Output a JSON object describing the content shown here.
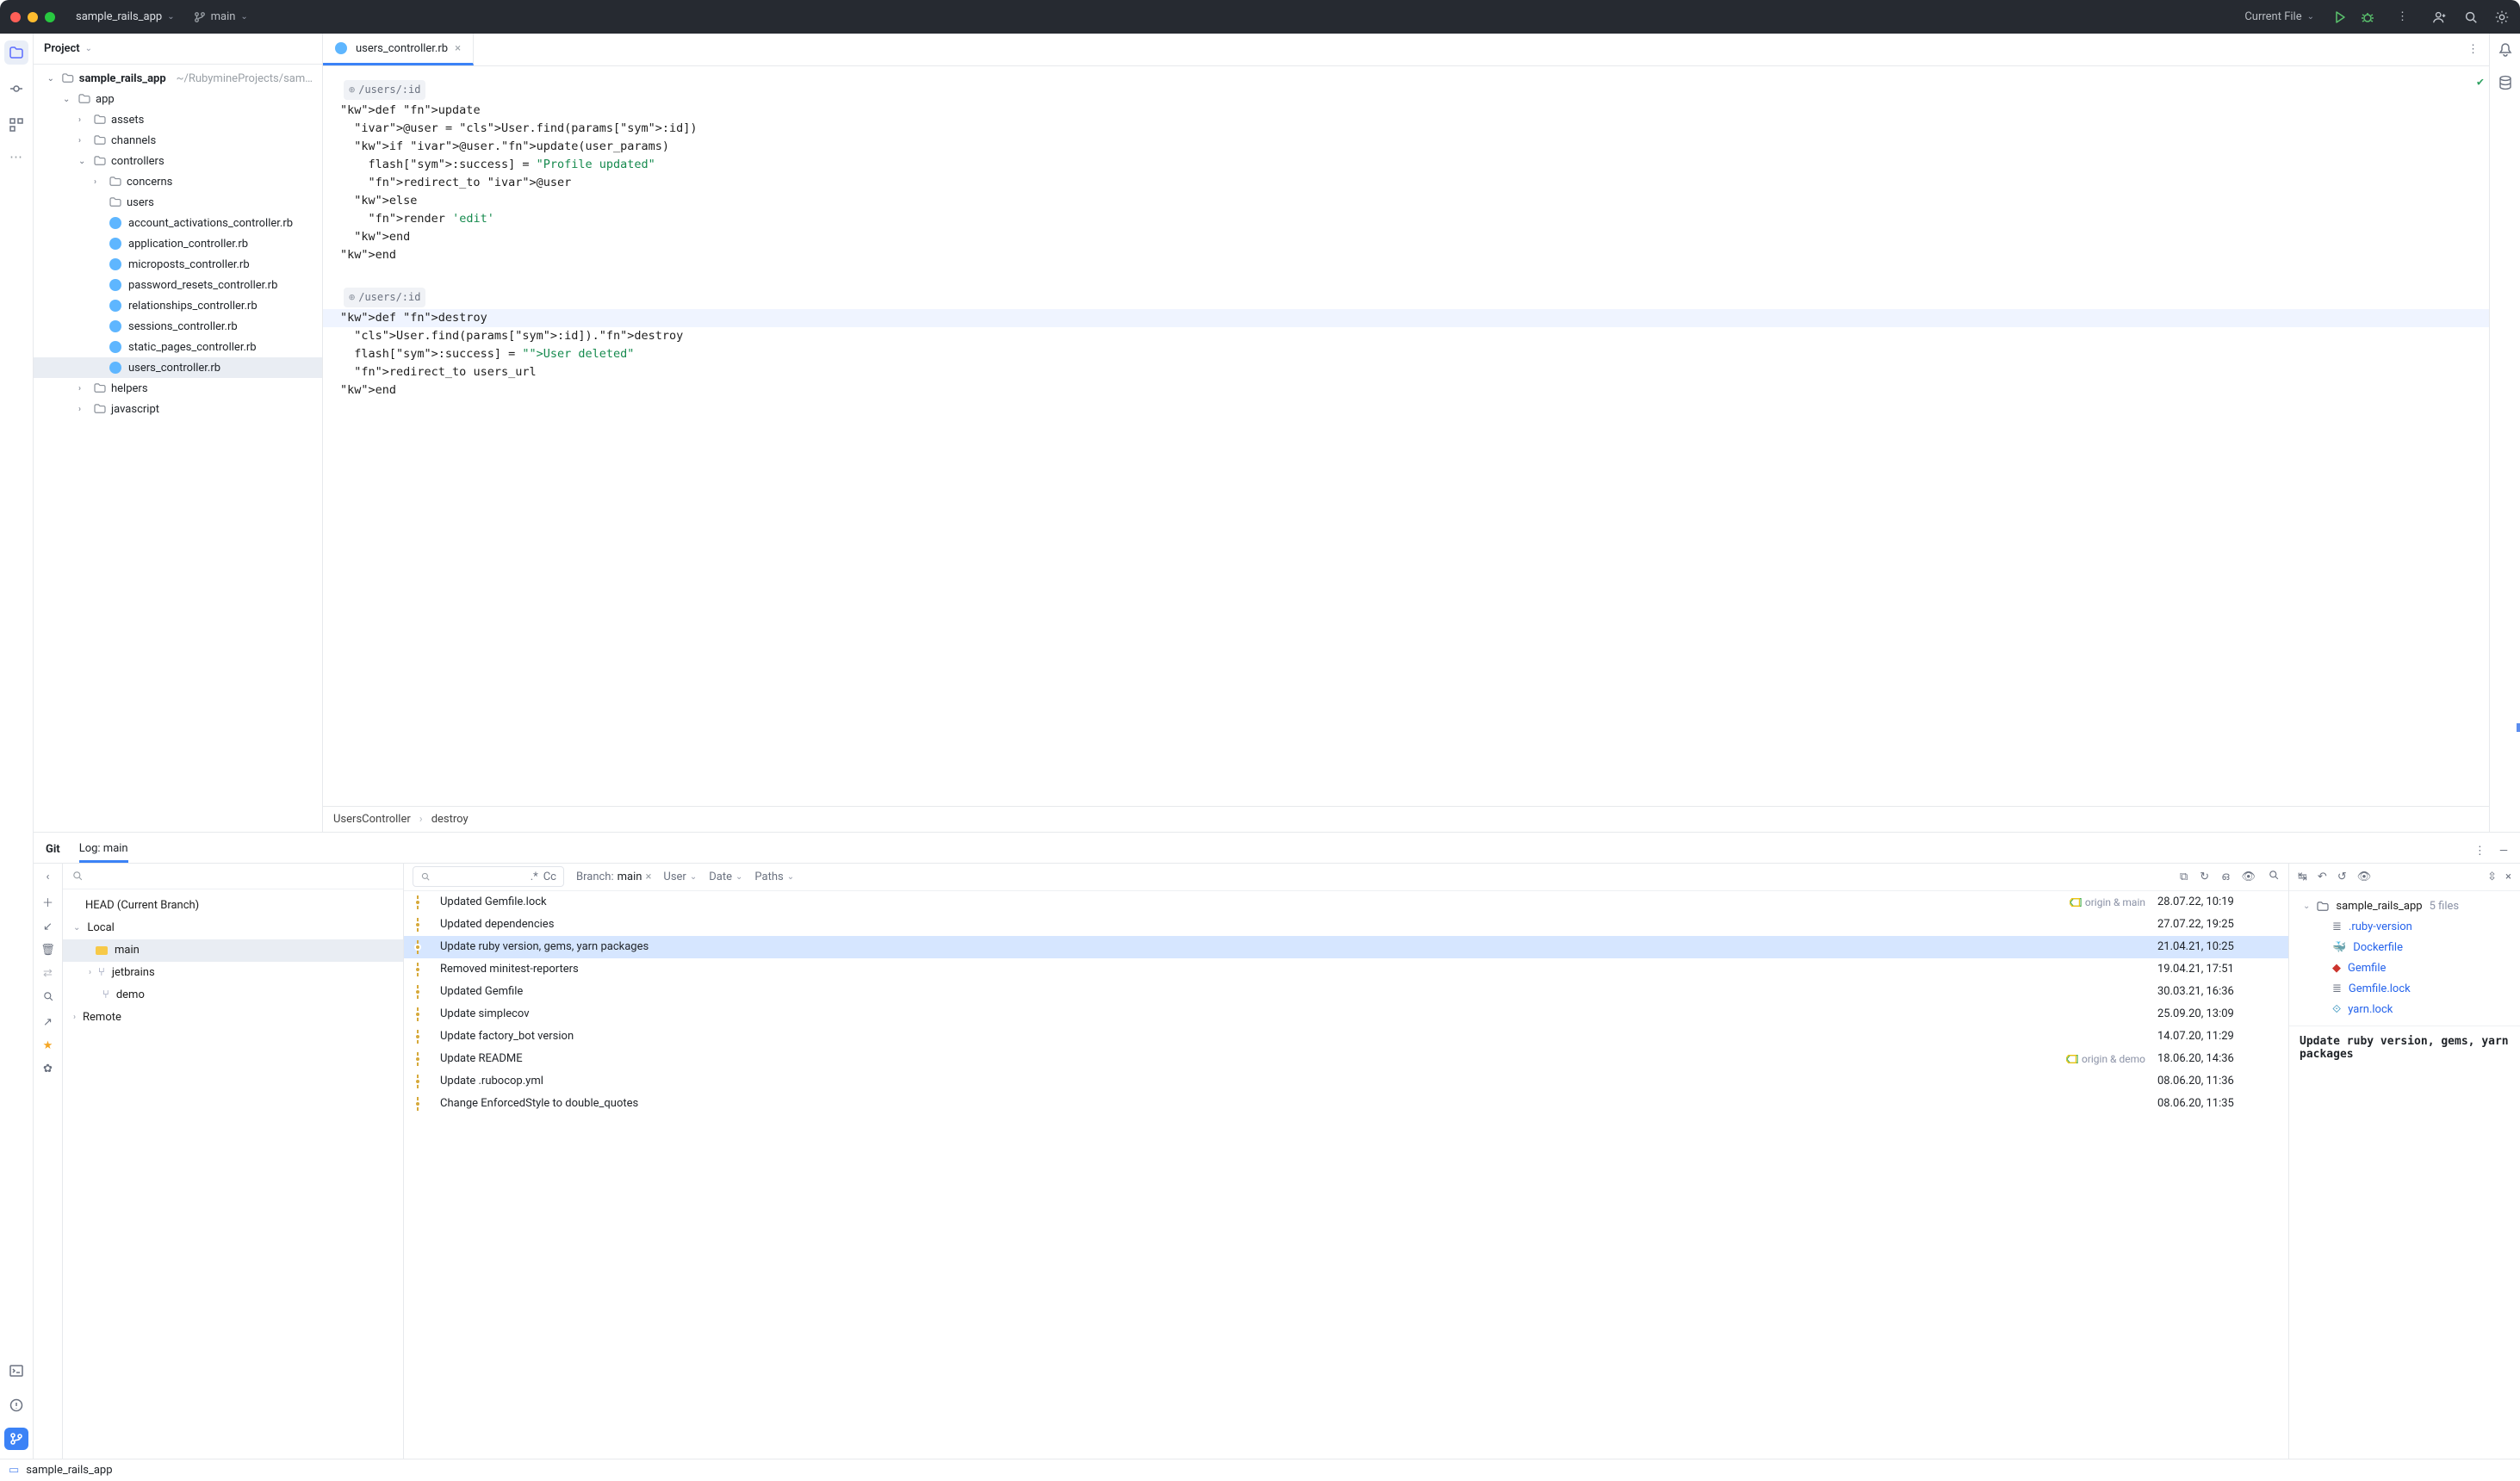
{
  "titlebar": {
    "project": "sample_rails_app",
    "branch": "main",
    "run_config": "Current File"
  },
  "project_pane": {
    "title": "Project",
    "root": {
      "name": "sample_rails_app",
      "pathhint": "~/RubymineProjects/sample"
    },
    "tree": [
      {
        "depth": 0,
        "type": "root"
      },
      {
        "depth": 1,
        "type": "folder",
        "name": "app",
        "expanded": true
      },
      {
        "depth": 2,
        "type": "folder",
        "name": "assets",
        "expanded": false
      },
      {
        "depth": 2,
        "type": "folder",
        "name": "channels",
        "expanded": false
      },
      {
        "depth": 2,
        "type": "folder",
        "name": "controllers",
        "expanded": true
      },
      {
        "depth": 3,
        "type": "folder",
        "name": "concerns",
        "expanded": false
      },
      {
        "depth": 3,
        "type": "folder-plain",
        "name": "users"
      },
      {
        "depth": 3,
        "type": "ruby",
        "name": "account_activations_controller.rb"
      },
      {
        "depth": 3,
        "type": "ruby",
        "name": "application_controller.rb"
      },
      {
        "depth": 3,
        "type": "ruby",
        "name": "microposts_controller.rb"
      },
      {
        "depth": 3,
        "type": "ruby",
        "name": "password_resets_controller.rb"
      },
      {
        "depth": 3,
        "type": "ruby",
        "name": "relationships_controller.rb"
      },
      {
        "depth": 3,
        "type": "ruby",
        "name": "sessions_controller.rb"
      },
      {
        "depth": 3,
        "type": "ruby",
        "name": "static_pages_controller.rb"
      },
      {
        "depth": 3,
        "type": "ruby",
        "name": "users_controller.rb",
        "selected": true
      },
      {
        "depth": 2,
        "type": "folder",
        "name": "helpers",
        "expanded": false
      },
      {
        "depth": 2,
        "type": "folder",
        "name": "javascript",
        "expanded": false
      }
    ]
  },
  "editor": {
    "tab": {
      "name": "users_controller.rb"
    },
    "route1": "/users/:id",
    "route2": "/users/:id",
    "code1": [
      "def update",
      "  @user = User.find(params[:id])",
      "  if @user.update(user_params)",
      "    flash[:success] = \"Profile updated\"",
      "    redirect_to @user",
      "  else",
      "    render 'edit'",
      "  end",
      "end"
    ],
    "code2": [
      "def destroy",
      "  User.find(params[:id]).destroy",
      "  flash[:success] = \"User deleted\"",
      "  redirect_to users_url",
      "end"
    ],
    "breadcrumbs": [
      "UsersController",
      "destroy"
    ]
  },
  "git": {
    "tab_git": "Git",
    "tab_log": "Log: main",
    "branches": {
      "head": "HEAD (Current Branch)",
      "local": "Local",
      "main": "main",
      "jetbrains": "jetbrains",
      "demo": "demo",
      "remote": "Remote"
    },
    "filter": {
      "branch_label": "Branch:",
      "branch_value": "main",
      "user": "User",
      "date": "Date",
      "paths": "Paths",
      "regex": ".*",
      "cc": "Cc"
    },
    "commits": [
      {
        "msg": "Updated Gemfile.lock",
        "ref": "origin & main",
        "date": "28.07.22, 10:19"
      },
      {
        "msg": "Updated dependencies",
        "date": "27.07.22, 19:25"
      },
      {
        "msg": "Update ruby version, gems, yarn packages",
        "date": "21.04.21, 10:25",
        "selected": true
      },
      {
        "msg": "Removed minitest-reporters",
        "date": "19.04.21, 17:51"
      },
      {
        "msg": "Updated Gemfile",
        "date": "30.03.21, 16:36"
      },
      {
        "msg": "Update simplecov",
        "date": "25.09.20, 13:09"
      },
      {
        "msg": "Update factory_bot version",
        "date": "14.07.20, 11:29"
      },
      {
        "msg": "Update README",
        "ref": "origin & demo",
        "date": "18.06.20, 14:36"
      },
      {
        "msg": "Update .rubocop.yml",
        "date": "08.06.20, 11:36"
      },
      {
        "msg": "Change EnforcedStyle to double_quotes",
        "date": "08.06.20, 11:35"
      }
    ],
    "detail": {
      "root": "sample_rails_app",
      "filecount": "5 files",
      "files": [
        {
          "name": ".ruby-version",
          "icon": "text"
        },
        {
          "name": "Dockerfile",
          "icon": "docker"
        },
        {
          "name": "Gemfile",
          "icon": "ruby"
        },
        {
          "name": "Gemfile.lock",
          "icon": "text"
        },
        {
          "name": "yarn.lock",
          "icon": "yarn"
        }
      ],
      "message": "Update ruby version, gems, yarn packages"
    }
  },
  "statusbar": {
    "project": "sample_rails_app"
  }
}
